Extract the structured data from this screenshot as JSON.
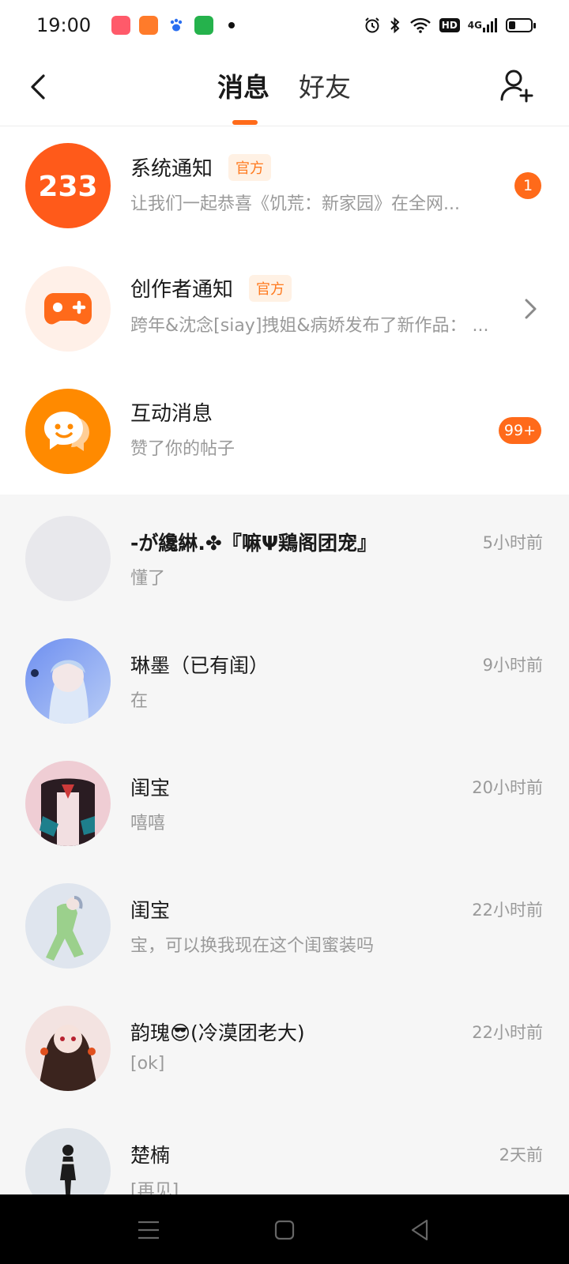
{
  "status_bar": {
    "time": "19:00",
    "app_icons": [
      {
        "name": "app-icon-1",
        "color": "#ff5a6a"
      },
      {
        "name": "app-icon-2",
        "color": "#ff7b2a"
      },
      {
        "name": "baidu-paw-icon",
        "color": "#2a6ff0"
      },
      {
        "name": "app-icon-4",
        "color": "#25b24c"
      }
    ],
    "hd_label": "HD",
    "network_label": "4G",
    "battery_level": 0.3
  },
  "header": {
    "tabs": [
      {
        "label": "消息",
        "active": true
      },
      {
        "label": "好友",
        "active": false
      }
    ],
    "accent_color": "#ff6b1a"
  },
  "official": [
    {
      "title": "系统通知",
      "tag": "官方",
      "subtitle": "让我们一起恭喜《饥荒：新家园》在全网...",
      "badge": "1",
      "icon": "233-logo-icon"
    },
    {
      "title": "创作者通知",
      "tag": "官方",
      "subtitle": "跨年&沈念[siay]拽姐&病娇发布了新作品：  ...",
      "icon": "gamepad-icon"
    },
    {
      "title": "互动消息",
      "subtitle": "赞了你的帖子",
      "badge": "99+",
      "icon": "chat-bubble-icon"
    }
  ],
  "chats": [
    {
      "name": "-が纔綝.✤『嘛Ψ鶏阁团宠』",
      "preview": "懂了",
      "time": "5小时前",
      "avatar_color": "#e8e8ec"
    },
    {
      "name": "琳墨（已有闺）",
      "preview": "在",
      "time": "9小时前",
      "avatar_color": "#8fb0ef"
    },
    {
      "name": "闺宝",
      "preview": "嘻嘻",
      "time": "20小时前",
      "avatar_color": "#e9c3cb"
    },
    {
      "name": "闺宝",
      "preview": "宝，可以换我现在这个闺蜜装吗",
      "time": "22小时前",
      "avatar_color": "#dfe5ee"
    },
    {
      "name": "韵瑰😎(冷漠团老大)",
      "preview": "[ok]",
      "time": "22小时前",
      "avatar_color": "#f0dede"
    },
    {
      "name": "楚楠",
      "preview": "[再见]",
      "time": "2天前",
      "avatar_color": "#dfe4ea"
    }
  ]
}
